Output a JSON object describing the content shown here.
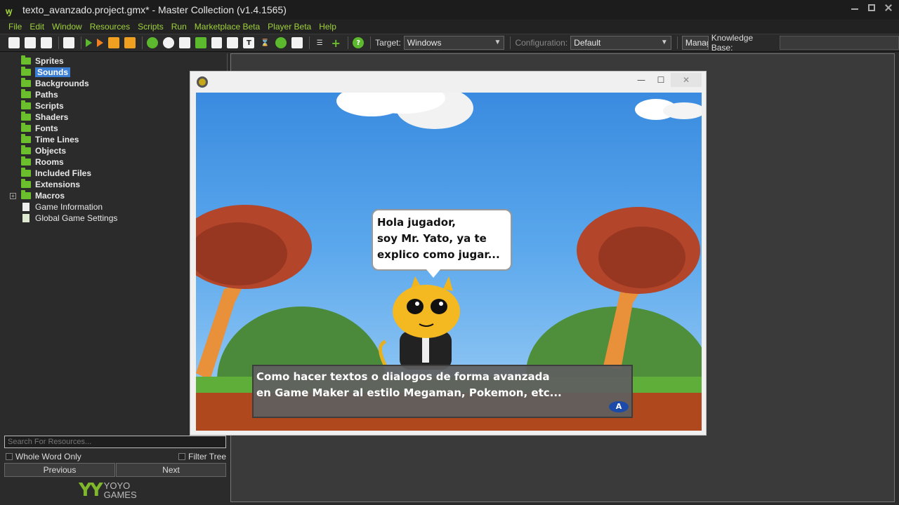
{
  "window": {
    "filename": "texto_avanzado.project.gmx*",
    "separator": "-",
    "app_title": "Master Collection (v1.4.1565)"
  },
  "menu": [
    "File",
    "Edit",
    "Window",
    "Resources",
    "Scripts",
    "Run",
    "Marketplace Beta",
    "Player Beta",
    "Help"
  ],
  "toolbar": {
    "target_label": "Target:",
    "target_value": "Windows",
    "configuration_label": "Configuration:",
    "configuration_value": "Default",
    "manage_label": "Manag",
    "knowledge_base_label": "Knowledge Base:",
    "knowledge_base_value": ""
  },
  "tree": {
    "items": [
      {
        "label": "Sprites",
        "type": "folder"
      },
      {
        "label": "Sounds",
        "type": "folder",
        "selected": true
      },
      {
        "label": "Backgrounds",
        "type": "folder"
      },
      {
        "label": "Paths",
        "type": "folder"
      },
      {
        "label": "Scripts",
        "type": "folder"
      },
      {
        "label": "Shaders",
        "type": "folder"
      },
      {
        "label": "Fonts",
        "type": "folder"
      },
      {
        "label": "Time Lines",
        "type": "folder"
      },
      {
        "label": "Objects",
        "type": "folder"
      },
      {
        "label": "Rooms",
        "type": "folder"
      },
      {
        "label": "Included Files",
        "type": "folder"
      },
      {
        "label": "Extensions",
        "type": "folder"
      },
      {
        "label": "Macros",
        "type": "folder",
        "expander": "+"
      },
      {
        "label": "Game Information",
        "type": "doc"
      },
      {
        "label": "Global Game Settings",
        "type": "doc"
      }
    ]
  },
  "search": {
    "placeholder": "Search For Resources...",
    "whole_word_only": "Whole Word Only",
    "filter_tree": "Filter Tree",
    "previous": "Previous",
    "next": "Next"
  },
  "branding": {
    "mark": "YY",
    "line1": "YOYO",
    "line2": "GAMES"
  },
  "game": {
    "bubble_lines": [
      "Hola jugador,",
      "soy Mr. Yato, ya te",
      "explico como jugar..."
    ],
    "dialog_lines": [
      "Como hacer textos o dialogos de forma avanzada",
      "en Game Maker al estilo Megaman, Pokemon, etc..."
    ],
    "button_label": "A",
    "close_glyph": "✕",
    "min_glyph": "—",
    "max_glyph": "☐"
  },
  "colors": {
    "accent_green": "#9fd23a",
    "selection_blue": "#3b7fd4",
    "sky_blue": "#4a99e6"
  }
}
